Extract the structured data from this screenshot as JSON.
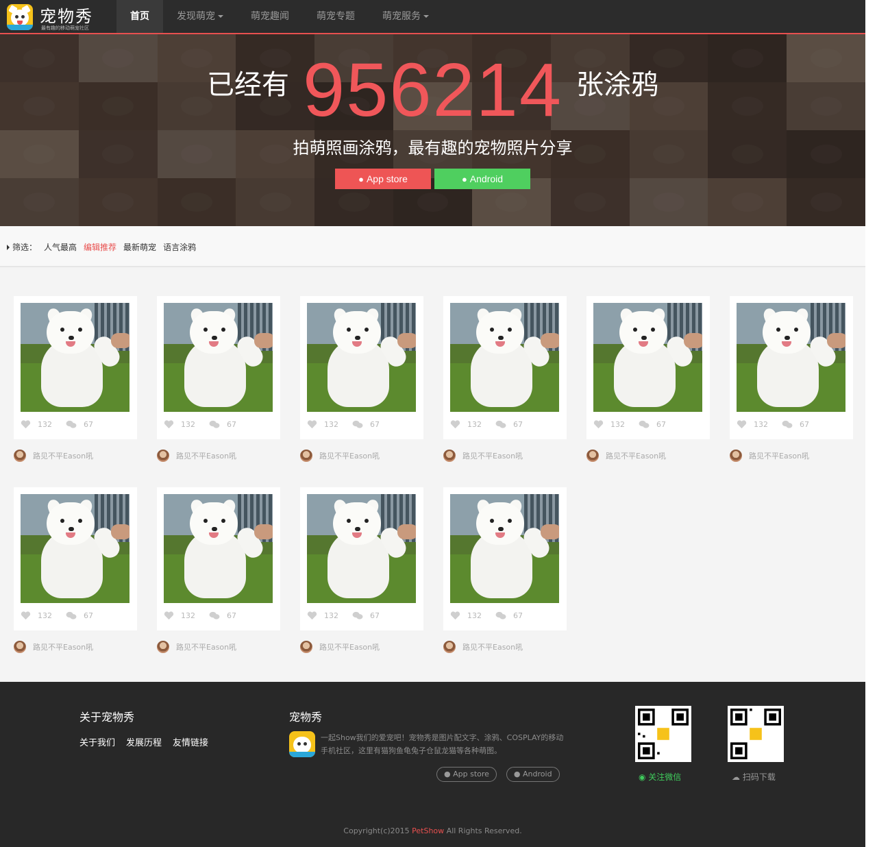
{
  "brand": {
    "name": "宠物秀",
    "slogan": "最有趣的移动萌宠社区",
    "accent_color": "#e8504f"
  },
  "nav": {
    "items": [
      {
        "label": "首页",
        "active": true,
        "dropdown": false
      },
      {
        "label": "发现萌宠",
        "active": false,
        "dropdown": true
      },
      {
        "label": "萌宠趣闻",
        "active": false,
        "dropdown": false
      },
      {
        "label": "萌宠专题",
        "active": false,
        "dropdown": false
      },
      {
        "label": "萌宠服务",
        "active": false,
        "dropdown": true
      }
    ]
  },
  "hero": {
    "prefix": "已经有",
    "count": "956214",
    "suffix": "张涂鸦",
    "tagline": "拍萌照画涂鸦，最有趣的宠物照片分享",
    "apple_button": "App store",
    "android_button": "Android",
    "apple_color": "#ee5555",
    "android_color": "#4fcf5f"
  },
  "filter": {
    "label": "筛选：",
    "options": [
      {
        "label": "人气最高",
        "active": false
      },
      {
        "label": "编辑推荐",
        "active": true
      },
      {
        "label": "最新萌宠",
        "active": false
      },
      {
        "label": "语言涂鸦",
        "active": false
      }
    ]
  },
  "cards": [
    {
      "likes": "132",
      "comments": "67",
      "author": "路见不平Eason吼"
    },
    {
      "likes": "132",
      "comments": "67",
      "author": "路见不平Eason吼"
    },
    {
      "likes": "132",
      "comments": "67",
      "author": "路见不平Eason吼"
    },
    {
      "likes": "132",
      "comments": "67",
      "author": "路见不平Eason吼"
    },
    {
      "likes": "132",
      "comments": "67",
      "author": "路见不平Eason吼"
    },
    {
      "likes": "132",
      "comments": "67",
      "author": "路见不平Eason吼"
    },
    {
      "likes": "132",
      "comments": "67",
      "author": "路见不平Eason吼"
    },
    {
      "likes": "132",
      "comments": "67",
      "author": "路见不平Eason吼"
    },
    {
      "likes": "132",
      "comments": "67",
      "author": "路见不平Eason吼"
    },
    {
      "likes": "132",
      "comments": "67",
      "author": "路见不平Eason吼"
    }
  ],
  "footer": {
    "about_title": "关于宠物秀",
    "about_links": [
      "关于我们",
      "发展历程",
      "友情链接"
    ],
    "app_title": "宠物秀",
    "app_desc": "一起Show我们的爱宠吧！宠物秀是图片配文字、涂鸦、COSPLAY的移动手机社区，这里有猫狗鱼龟兔子仓鼠龙猫等各种萌图。",
    "apple_button": "App store",
    "android_button": "Android",
    "wechat_label": "关注微信",
    "download_label": "扫码下载",
    "copyright_pre": "Copyright(c)2015 ",
    "copyright_brand": "PetShow",
    "copyright_post": " All Rights Reserved."
  }
}
